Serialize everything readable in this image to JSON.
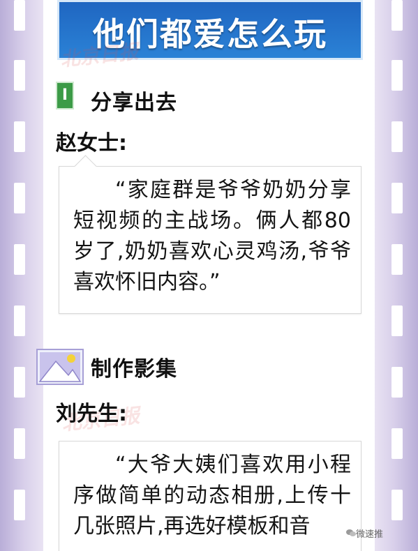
{
  "banner": {
    "title": "他们都爱怎么玩"
  },
  "section1": {
    "badge": "I",
    "title": "分享出去",
    "speaker": "赵女士:",
    "quote": "“家庭群是爷爷奶奶分享短视频的主战场。俩人都80岁了,奶奶喜欢心灵鸡汤,爷爷喜欢怀旧内容。”"
  },
  "section2": {
    "icon": "photo-icon",
    "title": "制作影集",
    "speaker": "刘先生:",
    "quote": "“大爷大姨们喜欢用小程序做简单的动态相册,上传十几张照片,再选好模板和音"
  },
  "watermark": {
    "text": "北京日报"
  },
  "footer": {
    "wechat_label": "微速推"
  },
  "colors": {
    "banner": "#1f66c1",
    "film": "#b9aed8",
    "badge": "#3c9b47"
  }
}
